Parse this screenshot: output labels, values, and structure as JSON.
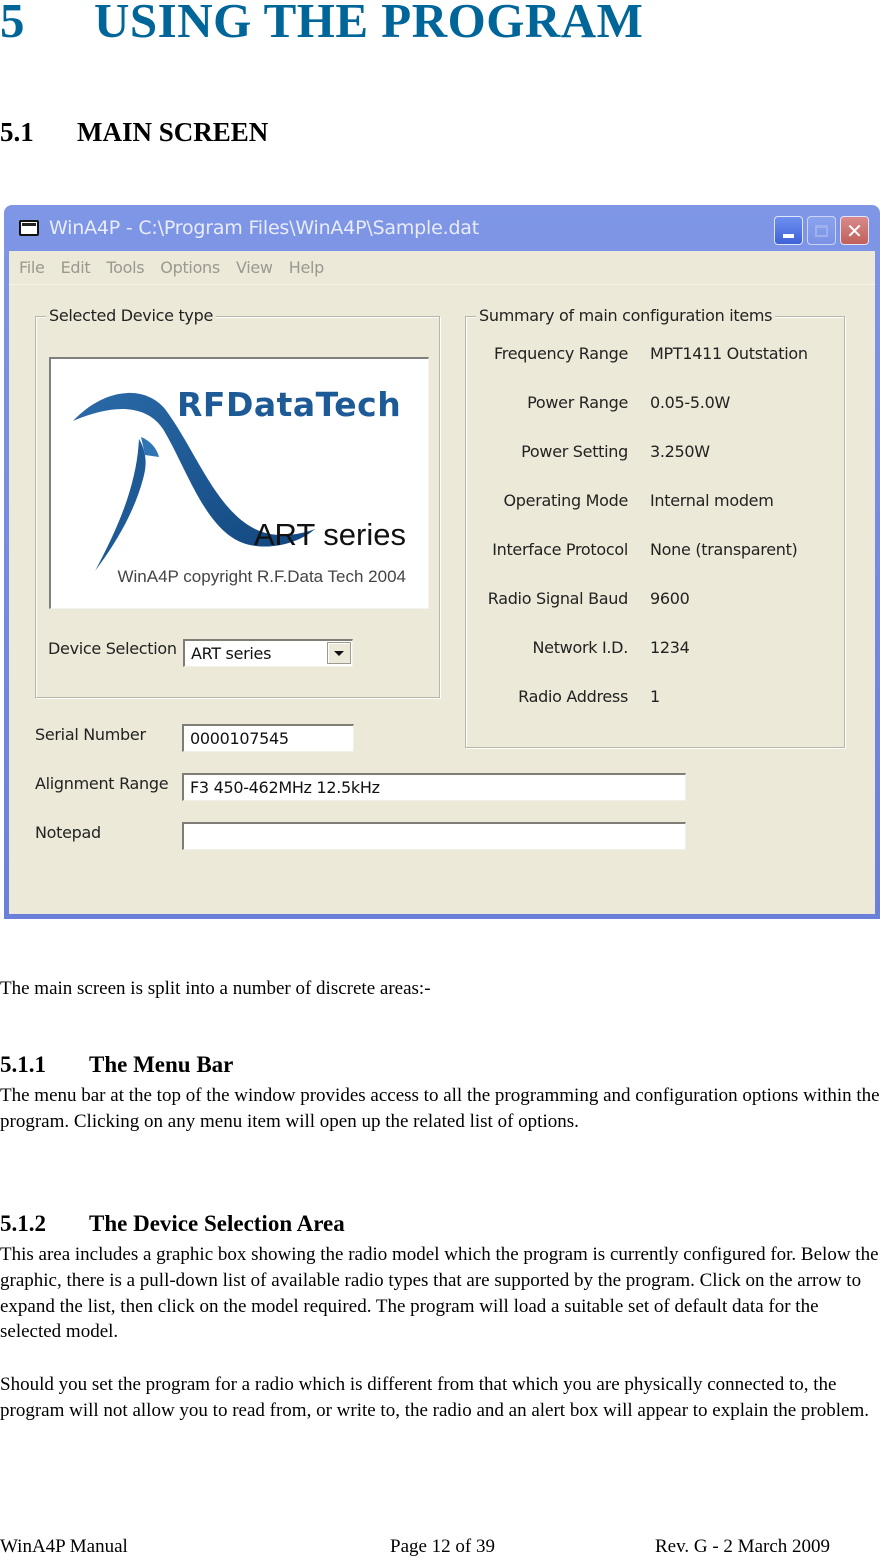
{
  "doc": {
    "chapter": {
      "number": "5",
      "title": "USING THE PROGRAM"
    },
    "section": {
      "number": "5.1",
      "title": "MAIN SCREEN"
    },
    "intro": "The main screen is split into a number of discrete areas:-",
    "subsections": [
      {
        "number": "5.1.1",
        "title": "The Menu Bar",
        "paragraphs": [
          "The menu bar at the top of the window provides access to all the programming and configuration options within the program.  Clicking on any menu item will open up the related list of options."
        ]
      },
      {
        "number": "5.1.2",
        "title": "The Device Selection Area",
        "paragraphs": [
          "This area includes a graphic box showing the radio model which the program is currently configured for.  Below the graphic, there is a pull-down list of available radio types that are supported by the program.  Click on the arrow to expand the list, then click on the model required.  The program will load a suitable set of default data for the selected model.",
          "Should you set the program for a radio which is different from that which you are physically connected to, the program will not allow you to read from, or write to, the radio and an alert box will appear to explain the problem."
        ]
      }
    ],
    "footer": {
      "left": "WinA4P Manual",
      "center": "Page 12 of 39",
      "right": "Rev. G -  2 March 2009"
    },
    "colors": {
      "chapter_heading": "#006699",
      "logo_blue": "#1d5a96",
      "window_bg": "#ece9d8"
    }
  },
  "window": {
    "title": "WinA4P - C:\\Program Files\\WinA4P\\Sample.dat",
    "icons": {
      "app": "app-window-icon",
      "minimize": "minimize-icon",
      "maximize": "maximize-icon",
      "close": "close-icon"
    },
    "close_glyph": "✕",
    "menu": [
      "File",
      "Edit",
      "Tools",
      "Options",
      "View",
      "Help"
    ],
    "device_group": {
      "legend": "Selected Device type",
      "logo": {
        "brand": "RFDataTech",
        "series": "ART series",
        "copyright": "WinA4P copyright R.F.Data Tech 2004"
      },
      "device_selection_label": "Device Selection",
      "device_selection_value": "ART series"
    },
    "summary_group": {
      "legend": "Summary of main configuration items",
      "rows": [
        {
          "label": "Frequency Range",
          "value": "MPT1411 Outstation"
        },
        {
          "label": "Power Range",
          "value": "0.05-5.0W"
        },
        {
          "label": "Power Setting",
          "value": "3.250W"
        },
        {
          "label": "Operating Mode",
          "value": "Internal modem"
        },
        {
          "label": "Interface Protocol",
          "value": "None (transparent)"
        },
        {
          "label": "Radio Signal Baud",
          "value": "9600"
        },
        {
          "label": "Network I.D.",
          "value": "1234"
        },
        {
          "label": "Radio Address",
          "value": "1"
        }
      ]
    },
    "fields": {
      "serial_label": "Serial Number",
      "serial_value": "0000107545",
      "alignment_label": "Alignment Range",
      "alignment_value": "F3 450-462MHz 12.5kHz",
      "notepad_label": "Notepad",
      "notepad_value": ""
    }
  }
}
